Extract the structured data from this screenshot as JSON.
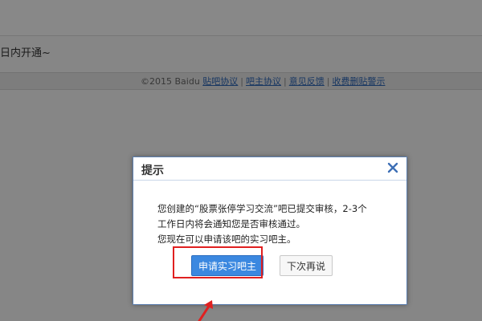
{
  "page": {
    "notice_text": "日内开通~",
    "footer": {
      "copyright": "©2015 Baidu",
      "links": [
        "贴吧协议",
        "吧主协议",
        "意见反馈",
        "收费删贴警示"
      ]
    }
  },
  "dialog": {
    "title": "提示",
    "message_lines": [
      "您创建的“股票张停学习交流”吧已提交审核，2-3个",
      "工作日内将会通知您是否审核通过。",
      "您现在可以申请该吧的实习吧主。"
    ],
    "primary_button": "申请实习吧主",
    "secondary_button": "下次再说"
  },
  "colors": {
    "primary_button": "#3b88e0",
    "highlight": "#e02020",
    "link": "#2d64b3"
  },
  "icons": {
    "close": "close-icon",
    "annotation": "red-arrow-icon"
  }
}
